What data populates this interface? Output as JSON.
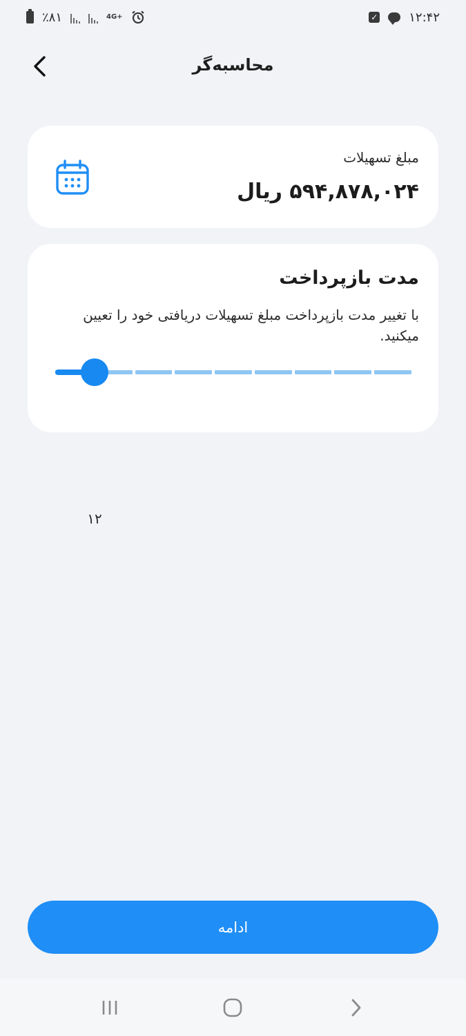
{
  "status_bar": {
    "battery_text": "٪۸۱",
    "network_label": "4G+",
    "time": "۱۲:۴۲"
  },
  "header": {
    "title": "محاسبه‌گر",
    "back_icon": "chevron-left-icon"
  },
  "loan_card": {
    "label": "مبلغ تسهیلات",
    "amount": "۵۹۴,۸۷۸,۰۲۴ ریال",
    "icon": "calendar-icon"
  },
  "duration_card": {
    "title": "مدت بازپرداخت",
    "description": "با تغییر مدت بازپرداخت مبلغ تسهیلات دریافتی خود را تعیین میکنید.",
    "slider": {
      "value_label": "۱۲",
      "position_fraction": 0.11,
      "segments": 9,
      "fill_color": "#1789f0",
      "track_color": "#8fc6f4"
    }
  },
  "continue_button": {
    "label": "ادامه",
    "color": "#1f8ef6"
  },
  "nav_bar": {
    "recent_icon": "recent-apps-icon",
    "home_icon": "home-icon",
    "back_icon": "back-icon"
  }
}
